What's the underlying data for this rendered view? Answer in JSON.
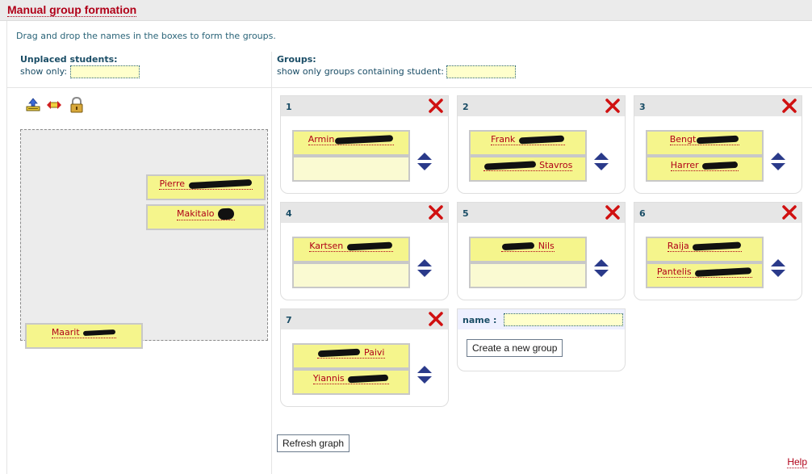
{
  "page": {
    "title": "Manual group formation",
    "instructions": "Drag and drop the names in the boxes to form the groups.",
    "help_label": "Help"
  },
  "unplaced": {
    "heading": "Unplaced students:",
    "filter_label": "show only:",
    "filter_value": "",
    "toolbar": [
      "import-students-icon",
      "swap-students-icon",
      "lock-icon"
    ],
    "students": [
      {
        "name": "Pierre"
      },
      {
        "name": "Makitalo"
      },
      {
        "name": "Maarit"
      }
    ]
  },
  "groups_panel": {
    "heading": "Groups:",
    "filter_label": "show only groups containing student:",
    "filter_value": "",
    "groups": [
      {
        "number": "1",
        "members": [
          "Armin",
          ""
        ]
      },
      {
        "number": "2",
        "members": [
          "Frank",
          "Stavros"
        ]
      },
      {
        "number": "3",
        "members": [
          "Bengt",
          "Harrer"
        ]
      },
      {
        "number": "4",
        "members": [
          "Kartsen",
          ""
        ]
      },
      {
        "number": "5",
        "members": [
          "Nils",
          ""
        ]
      },
      {
        "number": "6",
        "members": [
          "Raija",
          "Pantelis"
        ]
      },
      {
        "number": "7",
        "members": [
          "Paivi",
          "Yiannis"
        ]
      }
    ]
  },
  "new_group": {
    "name_label": "name :",
    "name_value": "",
    "create_label": "Create a new group"
  },
  "refresh_label": "Refresh graph",
  "colors": {
    "link_red": "#b00018",
    "name_yellow": "#f5f58c",
    "input_yellow": "#ffffcc",
    "text_teal": "#1a4d66",
    "delete_red": "#d01010",
    "arrow_blue": "#2a3a8a"
  }
}
